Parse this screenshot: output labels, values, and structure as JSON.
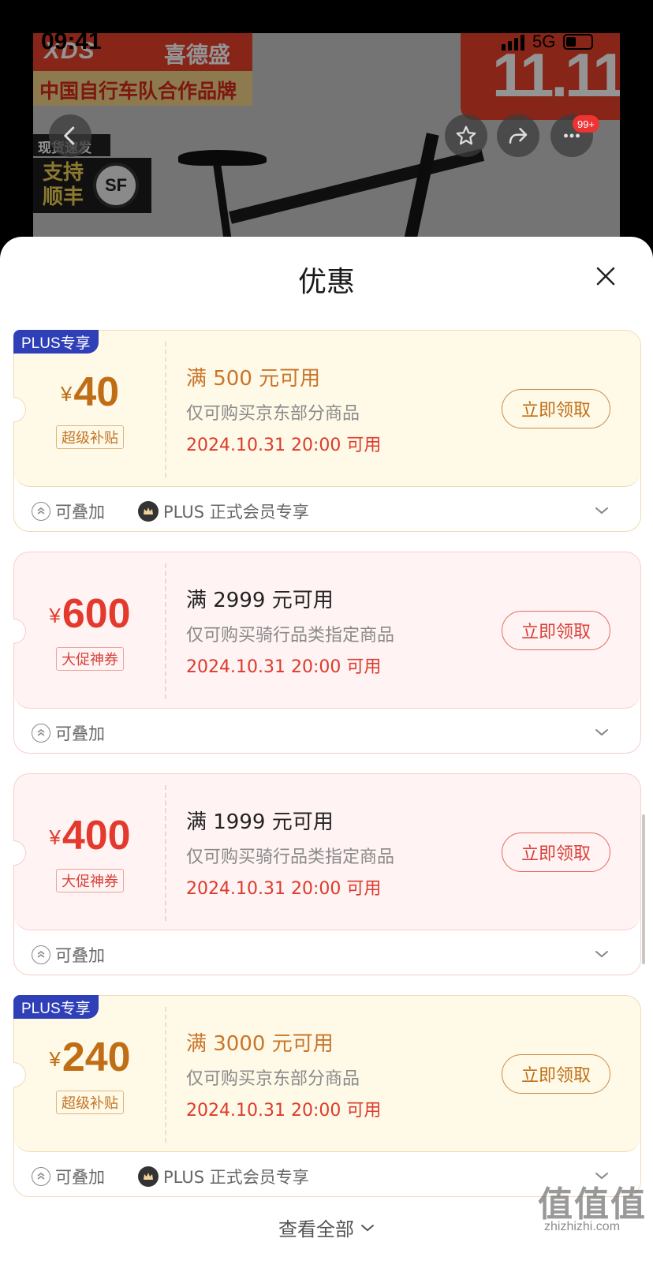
{
  "status_bar": {
    "time": "09:41",
    "network": "5G"
  },
  "product_banner": {
    "brand_logo": "XDS",
    "brand_name": "喜德盛",
    "slogan": "中国自行车队合作品牌",
    "promo": "11.11",
    "shipping_tag": "现货速发",
    "shipping_text": "支持顺丰",
    "courier_logo": "SF",
    "message_count": "99+"
  },
  "sheet": {
    "title": "优惠",
    "close_icon": "close-icon",
    "coupons": [
      {
        "style": "gold",
        "badge": "PLUS专享",
        "currency": "¥",
        "amount": "40",
        "tag": "超级补贴",
        "condition": "满 500 元可用",
        "scope": "仅可购买京东部分商品",
        "valid": "2024.10.31 20:00 可用",
        "button": "立即领取",
        "stackable": "可叠加",
        "member_note": "PLUS 正式会员专享"
      },
      {
        "style": "red",
        "badge": "",
        "currency": "¥",
        "amount": "600",
        "tag": "大促神券",
        "condition": "满 2999 元可用",
        "scope": "仅可购买骑行品类指定商品",
        "valid": "2024.10.31 20:00 可用",
        "button": "立即领取",
        "stackable": "可叠加",
        "member_note": ""
      },
      {
        "style": "red",
        "badge": "",
        "currency": "¥",
        "amount": "400",
        "tag": "大促神券",
        "condition": "满 1999 元可用",
        "scope": "仅可购买骑行品类指定商品",
        "valid": "2024.10.31 20:00 可用",
        "button": "立即领取",
        "stackable": "可叠加",
        "member_note": ""
      },
      {
        "style": "gold",
        "badge": "PLUS专享",
        "currency": "¥",
        "amount": "240",
        "tag": "超级补贴",
        "condition": "满 3000 元可用",
        "scope": "仅可购买京东部分商品",
        "valid": "2024.10.31 20:00 可用",
        "button": "立即领取",
        "stackable": "可叠加",
        "member_note": "PLUS 正式会员专享"
      }
    ],
    "view_all": "查看全部"
  },
  "watermark": {
    "text": "值值值",
    "url": "zhizhizhi.com"
  },
  "colors": {
    "gold_text": "#bf6e16",
    "red_text": "#e43a2e",
    "plus_badge": "#2f3fb8",
    "gold_bg": "#fffae8",
    "red_bg": "#fff4f3"
  }
}
